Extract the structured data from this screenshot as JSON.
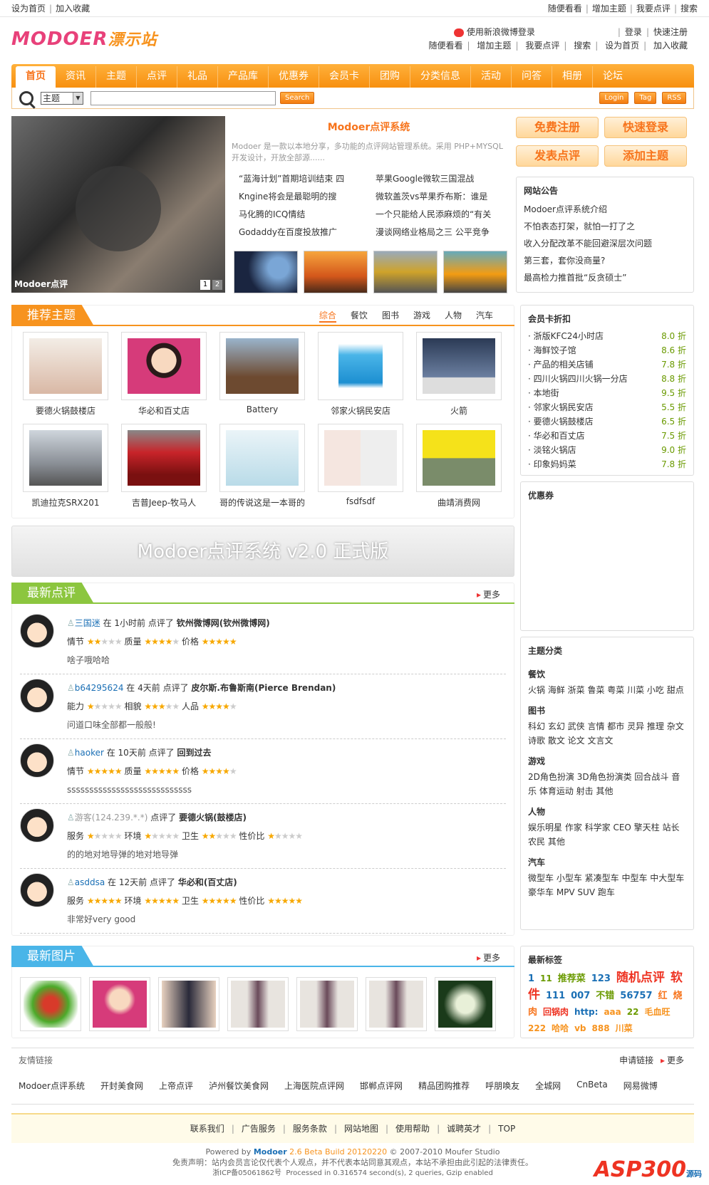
{
  "topbar": {
    "left": [
      "设为首页",
      "加入收藏"
    ],
    "right": [
      "随便看看",
      "增加主题",
      "我要点评",
      "搜索"
    ]
  },
  "header": {
    "logo_main": "MODOER",
    "logo_sub": "漂示站",
    "weibo_login": "使用新浪微博登录",
    "login": "登录",
    "register": "快速注册",
    "links": [
      "随便看看",
      "增加主题",
      "我要点评",
      "搜索",
      "设为首页",
      "加入收藏"
    ]
  },
  "nav": [
    "首页",
    "资讯",
    "主题",
    "点评",
    "礼品",
    "产品库",
    "优惠券",
    "会员卡",
    "团购",
    "分类信息",
    "活动",
    "问答",
    "相册",
    "论坛"
  ],
  "search": {
    "select": "主题",
    "button": "Search",
    "right": [
      "Login",
      "Tag",
      "RSS"
    ]
  },
  "featured": {
    "caption": "Modoer点评",
    "pages": [
      "1",
      "2"
    ]
  },
  "intro": {
    "title": "Modoer点评系统",
    "desc": "Modoer 是一款以本地分享，多功能的点评网站管理系统。采用 PHP+MYSQL 开发设计，开放全部源......",
    "news": [
      "“蓝海计划”首期培训结束 四",
      "苹果Google微软三国混战",
      "Kngine将会是最聪明的搜",
      "微软盖茨vs苹果乔布斯：谁是",
      "马化腾的ICQ情结",
      "一个只能给人民添麻烦的“有关",
      "Godaddy在百度投放推广",
      "漫谈网络业格局之三 公平竞争"
    ]
  },
  "actions": [
    "免费注册",
    "快速登录",
    "发表点评",
    "添加主题"
  ],
  "notice": {
    "title": "网站公告",
    "items": [
      "Modoer点评系统介绍",
      "不怕表态打架，就怕一打了之",
      "收入分配改革不能回避深层次问题",
      "第三套，套你没商量?",
      "最高检力推首批“反贪硕士”"
    ]
  },
  "recommend": {
    "title": "推荐主题",
    "tabs": [
      "综合",
      "餐饮",
      "图书",
      "游戏",
      "人物",
      "汽车"
    ],
    "items": [
      "要德火锅鼓楼店",
      "华必和百丈店",
      "Battery",
      "邻家火锅民安店",
      "火箭",
      "凯迪拉克SRX201",
      "吉普Jeep-牧马人",
      "哥的传说这是一本哥的",
      "fsdfsdf",
      "曲靖消费网"
    ]
  },
  "banner": "Modoer点评系统 v2.0 正式版",
  "reviews": {
    "title": "最新点评",
    "more": "更多",
    "items": [
      {
        "user": "三国迷",
        "time": "在 1小时前",
        "act": "点评了",
        "target": "钦州微博网(钦州微博网)",
        "r": [
          [
            "情节",
            "2"
          ],
          [
            "质量",
            "4"
          ],
          [
            "价格",
            "5"
          ]
        ],
        "content": "啥子哦哈哈"
      },
      {
        "user": "b64295624",
        "time": "在 4天前",
        "act": "点评了",
        "target": "皮尔斯.布鲁斯南(Pierce Brendan)",
        "r": [
          [
            "能力",
            "1"
          ],
          [
            "相貌",
            "3"
          ],
          [
            "人品",
            "4"
          ]
        ],
        "content": "问道口味全部都一般般!"
      },
      {
        "user": "haoker",
        "time": "在 10天前",
        "act": "点评了",
        "target": "回到过去",
        "r": [
          [
            "情节",
            "5"
          ],
          [
            "质量",
            "5"
          ],
          [
            "价格",
            "4"
          ]
        ],
        "content": "ssssssssssssssssssssssssssss"
      },
      {
        "user": "游客(124.239.*.*)",
        "time": "",
        "act": "点评了",
        "target": "要德火锅(鼓楼店)",
        "r": [
          [
            "服务",
            "1"
          ],
          [
            "环境",
            "1"
          ],
          [
            "卫生",
            "2"
          ],
          [
            "性价比",
            "1"
          ]
        ],
        "content": "的的地对地导弹的地对地导弹"
      },
      {
        "user": "asddsa",
        "time": "在 12天前",
        "act": "点评了",
        "target": "华必和(百丈店)",
        "r": [
          [
            "服务",
            "5"
          ],
          [
            "环境",
            "5"
          ],
          [
            "卫生",
            "5"
          ],
          [
            "性价比",
            "5"
          ]
        ],
        "content": "非常好very good"
      }
    ]
  },
  "discounts": {
    "title": "会员卡折扣",
    "items": [
      [
        "浙版KFC24小时店",
        "8.0 折"
      ],
      [
        "海鲜饺子馆",
        "8.6 折"
      ],
      [
        "产品的相关店铺",
        "7.8 折"
      ],
      [
        "四川火锅四川火锅一分店",
        "8.8 折"
      ],
      [
        "本地街",
        "9.5 折"
      ],
      [
        "邻家火锅民安店",
        "5.5 折"
      ],
      [
        "要德火锅鼓楼店",
        "6.5 折"
      ],
      [
        "华必和百丈店",
        "7.5 折"
      ],
      [
        "淡铭火锅店",
        "9.0 折"
      ],
      [
        "印象妈妈菜",
        "7.8 折"
      ]
    ]
  },
  "coupons": {
    "title": "优惠券"
  },
  "categories": {
    "title": "主题分类",
    "groups": [
      {
        "name": "餐饮",
        "items": "火锅 海鲜 浙菜 鲁菜 粤菜 川菜 小吃 甜点"
      },
      {
        "name": "图书",
        "items": "科幻 玄幻 武侠 言情 都市 灵异 推理 杂文 诗歌 散文 论文 文言文"
      },
      {
        "name": "游戏",
        "items": "2D角色扮演 3D角色扮演类 回合战斗 音乐 体育运动 射击 其他"
      },
      {
        "name": "人物",
        "items": "娱乐明星 作家 科学家 CEO 擎天柱 站长 农民 其他"
      },
      {
        "name": "汽车",
        "items": "微型车 小型车 紧凑型车 中型车 中大型车 豪华车 MPV SUV 跑车"
      }
    ]
  },
  "photos": {
    "title": "最新图片",
    "more": "更多"
  },
  "tags": {
    "title": "最新标签",
    "items": [
      "1",
      "11",
      "推荐菜",
      "123",
      "随机点评",
      "软件",
      "111",
      "007",
      "不错",
      "56757",
      "红",
      "烧肉",
      "回锅肉",
      "http:",
      "aaa",
      "22",
      "毛血旺",
      "222",
      "哈哈",
      "vb",
      "888",
      "川菜"
    ]
  },
  "links": {
    "title": "友情链接",
    "apply": "申请链接",
    "more": "更多",
    "items": [
      "Modoer点评系统",
      "开封美食网",
      "上帝点评",
      "泸州餐饮美食网",
      "上海医院点评网",
      "邯郸点评网",
      "精品团购推荐",
      "呼朋唤友",
      "全城网",
      "CnBeta",
      "网易微博"
    ]
  },
  "footer": {
    "nav": [
      "联系我们",
      "广告服务",
      "服务条款",
      "网站地图",
      "使用帮助",
      "诚聘英才",
      "TOP"
    ],
    "powered": "Powered by",
    "brand": "Modoer",
    "ver": "2.6 Beta Build 20120220",
    "copy": "© 2007-2010 Moufer Studio",
    "disclaimer": "免责声明：站内会员言论仅代表个人观点，并不代表本站同意其观点，本站不承担由此引起的法律责任。",
    "icp": "浙ICP备05061862号",
    "proc": "Processed in 0.316574 second(s), 2 queries, Gzip enabled",
    "asp": "ASP300",
    "asp_sub": "源码"
  }
}
